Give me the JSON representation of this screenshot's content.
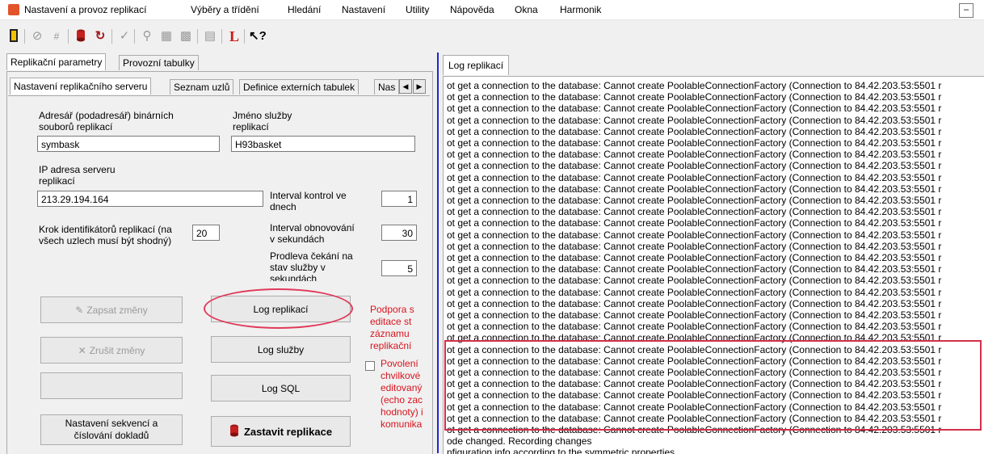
{
  "menu": {
    "items": [
      "Nastavení a provoz replikací",
      "Výběry a třídění",
      "Hledání",
      "Nastavení",
      "Utility",
      "Nápověda",
      "Okna",
      "Harmonik"
    ],
    "minimize": "–"
  },
  "toolbar": {
    "icons": [
      "exit-icon",
      "cancel-icon",
      "hash-icon",
      "database-icon",
      "refresh-icon",
      "check-icon",
      "search-icon",
      "print-icon",
      "grid-icon",
      "table-icon",
      "log-l-icon",
      "help-cursor-icon"
    ]
  },
  "outer_tabs": [
    "Replikační parametry",
    "Provozní tabulky"
  ],
  "inner_tabs": [
    "Nastavení replikačního serveru",
    "Seznam uzlů",
    "Definice externích tabulek",
    "Nas"
  ],
  "form": {
    "dir_label_1": "Adresář (podadresář) binárních",
    "dir_label_2": "souborů replikací",
    "dir_value": "symbask",
    "service_label_1": "Jméno služby",
    "service_label_2": "replikací",
    "service_value": "H93basket",
    "ip_label_1": "IP adresa serveru",
    "ip_label_2": "replikací",
    "ip_value": "213.29.194.164",
    "interval_days_label_1": "Interval kontrol ve",
    "interval_days_label_2": "dnech",
    "interval_days_value": "1",
    "step_label_1": "Krok identifikátorů replikací (na",
    "step_label_2": "všech uzlech musí být shodný)",
    "step_value": "20",
    "refresh_label_1": "Interval obnovování",
    "refresh_label_2": "v sekundách",
    "refresh_value": "30",
    "wait_label_1": "Prodleva čekání na",
    "wait_label_2": "stav služby v",
    "wait_label_3": "sekundách",
    "wait_value": "5"
  },
  "buttons": {
    "save": "Zapsat změny",
    "cancel": "Zrušit změny",
    "blank": "",
    "sequences_1": "Nastavení sekvencí a",
    "sequences_2": "číslování dokladů",
    "log_repl": "Log replikací",
    "log_service": "Log služby",
    "log_sql": "Log SQL",
    "stop": "Zastavit replikace"
  },
  "side_text": {
    "support": [
      "Podpora s",
      "editace st",
      "záznamu",
      "replikační"
    ],
    "permit": [
      "Povolení",
      "chvilkové",
      "editovaný",
      "(echo zac",
      "hodnoty) i",
      "komunika"
    ]
  },
  "log": {
    "tab": "Log replikací",
    "error_line": "ot get a connection to the database: Cannot create PoolableConnectionFactory (Connection to 84.42.203.53:5501 r",
    "error_count": 31,
    "tail": [
      "ode changed.  Recording changes",
      "nfiguration info according to the symmetric properties"
    ]
  },
  "colors": {
    "accent_blue": "#1f25d6",
    "highlight_red": "#d32f4a",
    "warning_red": "#d8141e"
  }
}
